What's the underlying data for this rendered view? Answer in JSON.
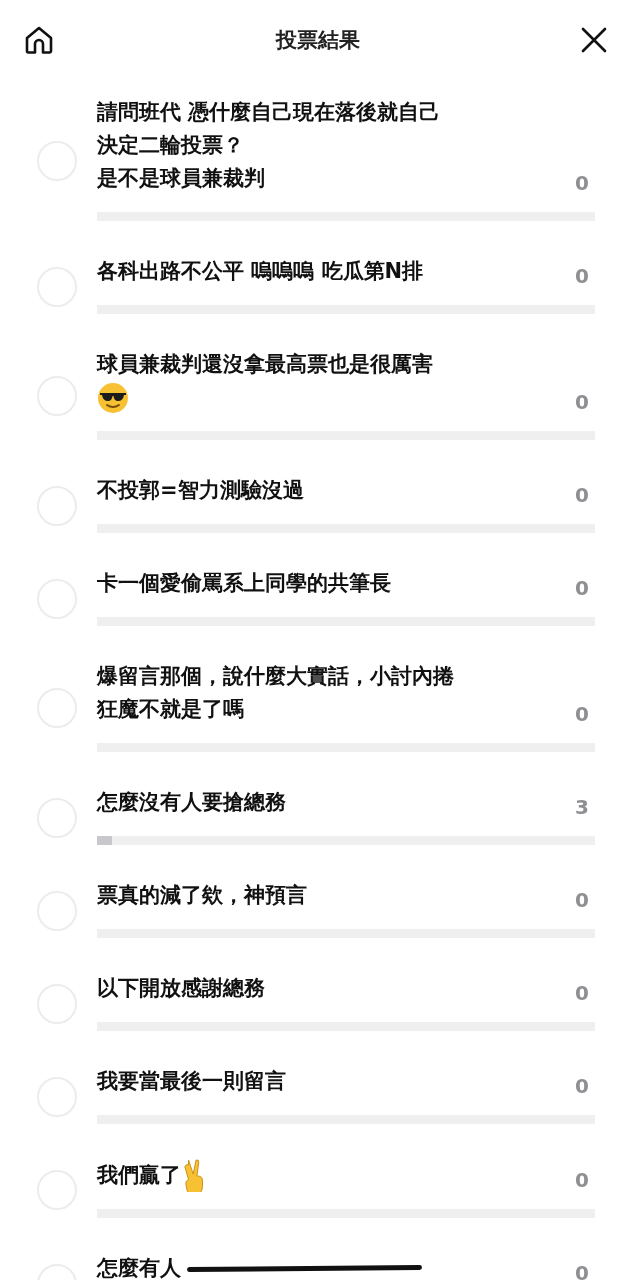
{
  "header": {
    "title": "投票結果"
  },
  "options": [
    {
      "lines": [
        "請問班代 憑什麼自己現在落後就自己",
        "決定二輪投票？",
        "是不是球員兼裁判"
      ],
      "count": "0",
      "selected": false
    },
    {
      "lines": [
        "各科出路不公平 嗚嗚嗚 吃瓜第N排"
      ],
      "count": "0",
      "selected": false
    },
    {
      "lines": [
        "球員兼裁判還沒拿最高票也是很厲害"
      ],
      "kind": "sunglasses_emoji",
      "count": "0",
      "selected": false
    },
    {
      "lines": [
        "不投郭=智力測驗沒過"
      ],
      "count": "0",
      "selected": false
    },
    {
      "lines": [
        "卡一個愛偷罵系上同學的共筆長"
      ],
      "count": "0",
      "selected": false
    },
    {
      "lines": [
        "爆留言那個，說什麼大實話，小討內捲",
        "狂魔不就是了嗎"
      ],
      "count": "0",
      "selected": false
    },
    {
      "lines": [
        "怎麼沒有人要搶總務"
      ],
      "count": "3",
      "level": 0.03,
      "selected": false
    },
    {
      "lines": [
        "票真的減了欸，神預言"
      ],
      "count": "0",
      "selected": false
    },
    {
      "lines": [
        "以下開放感謝總務"
      ],
      "count": "0",
      "selected": false
    },
    {
      "lines": [
        "我要當最後一則留言"
      ],
      "count": "0",
      "selected": false
    },
    {
      "lines": [
        "我們贏了"
      ],
      "kind": "victory_emoji",
      "count": "0",
      "selected": false
    },
    {
      "lines": [
        "怎麼有人"
      ],
      "scribbled": true,
      "count": "0",
      "selected": false
    }
  ]
}
